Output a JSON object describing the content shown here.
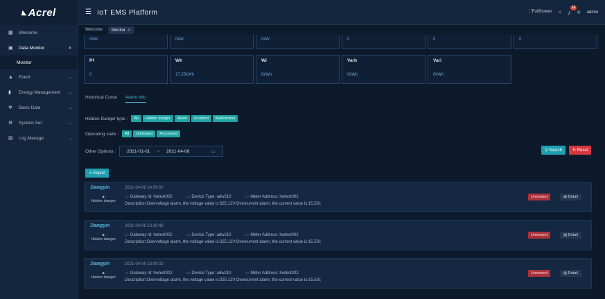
{
  "app": {
    "logo": "Acrel",
    "title": "IoT EMS Platform"
  },
  "header": {
    "fullscreen": "FullScreen",
    "notification_count": "14",
    "user": "admin"
  },
  "sidebar": {
    "items": [
      {
        "label": "Welcome",
        "icon": "dashboard-icon"
      },
      {
        "label": "Data Monitor",
        "icon": "monitor-icon"
      },
      {
        "label": "Monitor",
        "icon": ""
      },
      {
        "label": "Event",
        "icon": "warning-icon"
      },
      {
        "label": "Energy Management",
        "icon": "bar-chart-icon"
      },
      {
        "label": "Basic Data",
        "icon": "gear-icon"
      },
      {
        "label": "System Set",
        "icon": "settings-icon"
      },
      {
        "label": "Log Manage",
        "icon": "log-icon"
      }
    ]
  },
  "tabs": [
    {
      "label": "Welcome"
    },
    {
      "label": "Monitor"
    }
  ],
  "metrics_top": [
    {
      "value": "0kW"
    },
    {
      "value": "0kW"
    },
    {
      "value": "0kW"
    },
    {
      "value": "0"
    },
    {
      "value": "0"
    },
    {
      "value": "0"
    }
  ],
  "metrics": [
    {
      "name": "Pf",
      "value": "0"
    },
    {
      "name": "Wh",
      "value": "17.25kWh"
    },
    {
      "name": "Wi",
      "value": "0kWh"
    },
    {
      "name": "Varh",
      "value": "0kWh"
    },
    {
      "name": "Vari",
      "value": "0kWh"
    }
  ],
  "subtabs": [
    {
      "label": "Historical Curve"
    },
    {
      "label": "Alarm Info"
    }
  ],
  "filters": {
    "hidden_danger_label": "Hidden Danger type :",
    "hidden_danger_options": [
      "All",
      "Hidden danger",
      "Alarm",
      "Accident",
      "Malfunction"
    ],
    "operating_label": "Operating state :",
    "operating_options": [
      "All",
      "Untreated",
      "Processed"
    ],
    "other_label": "Other Options :",
    "date_start": "2021-01-01",
    "date_sep": "~",
    "date_end": "2021-04-06"
  },
  "buttons": {
    "search": "Search",
    "reset": "Reset",
    "export": "Export"
  },
  "alarms": [
    {
      "user": "Jiangyin",
      "time": "2021-04-06 14:09:02",
      "type": "Hidden danger",
      "gateway": "Gateway Id: hwtest002",
      "device": "Device Type: adw210",
      "meter": "Meter Address: hwtest002",
      "description": "Description:Overvoltage alarm, the voltage value is:325.12V;Overcurrent alarm, the current value is:15.53I;",
      "status": "Untreated",
      "detail": "Detail"
    },
    {
      "user": "Jiangyin",
      "time": "2021-04-06 13:39:48",
      "type": "Hidden danger",
      "gateway": "Gateway Id: hwtest002",
      "device": "Device Type: adw210",
      "meter": "Meter Address: hwtest002",
      "description": "Description:Overvoltage alarm, the voltage value is:325.12V;Overcurrent alarm, the current value is:15.53I;",
      "status": "Untreated",
      "detail": "Detail"
    },
    {
      "user": "Jiangyin",
      "time": "2021-04-06 13:09:02",
      "type": "Hidden danger",
      "gateway": "Gateway Id: hwtest002",
      "device": "Device Type: adw210",
      "meter": "Meter Address: hwtest002",
      "description": "Description:Overvoltage alarm, the voltage value is:325.12V;Overcurrent alarm, the current value is:15.53I;",
      "status": "Untreated",
      "detail": "Detail"
    }
  ]
}
